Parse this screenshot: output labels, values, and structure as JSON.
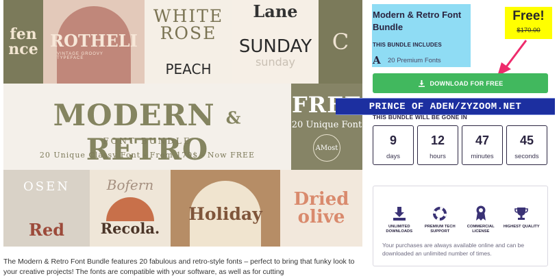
{
  "hero": {
    "tiles": {
      "t1": "fen\nnce",
      "t2_title": "ROTHELI",
      "t2_sub": "VINTAGE GROOVY TYPEFACE",
      "t3_a": "WHITE\nROSE",
      "t3_b": "PEACH",
      "t4_a": "Lane",
      "t4_b": "SUNDAY",
      "t4_c": "sunday",
      "t5": "C"
    },
    "banner_title": "MODERN",
    "banner_amp": "&",
    "banner_title2": "RETRO",
    "banner_sub": "FONT BUNDLE",
    "banner_price": "20 Unique Classy Font - From 170$ - Now FREE",
    "free_big": "FREE",
    "free_small": "20 Unique Font",
    "free_logo": "AMost",
    "bottom": {
      "b1_a": "OSEN",
      "b1_b": "Red",
      "b2_a": "Bofern",
      "b2_b": "Recola.",
      "b3": "Holiday",
      "b4": "Dried\nolive"
    }
  },
  "description": "The Modern & Retro Font Bundle features 20 fabulous and retro-style fonts – perfect to bring that funky look to your creative projects! The fonts are compatible with your software, as well as for cutting",
  "product": {
    "title": "Modern & Retro Font Bundle",
    "includes_label": "THIS BUNDLE INCLUDES",
    "fonts_glyph": "A",
    "fonts_label": "20 Premium Fonts"
  },
  "badge": {
    "free": "Free!",
    "old_price": "$170.00",
    "color": "#ffff00"
  },
  "download_label": "DOWNLOAD FOR FREE",
  "watermark": "PRINCE OF ADEN/ZYZOOM.NET",
  "gone_label": "THIS BUNDLE WILL BE GONE IN",
  "countdown": [
    {
      "value": "9",
      "unit": "days"
    },
    {
      "value": "12",
      "unit": "hours"
    },
    {
      "value": "47",
      "unit": "minutes"
    },
    {
      "value": "45",
      "unit": "seconds"
    }
  ],
  "features": [
    {
      "icon": "download-icon",
      "label": "UNLIMITED DOWNLOADS"
    },
    {
      "icon": "lifebuoy-icon",
      "label": "PREMIUM TECH SUPPORT"
    },
    {
      "icon": "award-ribbon-icon",
      "label": "COMMERCIAL LICENSE"
    },
    {
      "icon": "trophy-icon",
      "label": "HIGHEST QUALITY"
    }
  ],
  "features_note": "Your purchases are always available online and can be downloaded an unlimited number of times.",
  "colors": {
    "accent_green": "#41b85e",
    "title_bg": "#8fdcf4",
    "dark": "#2a2440",
    "arrow": "#ee2b6c"
  }
}
